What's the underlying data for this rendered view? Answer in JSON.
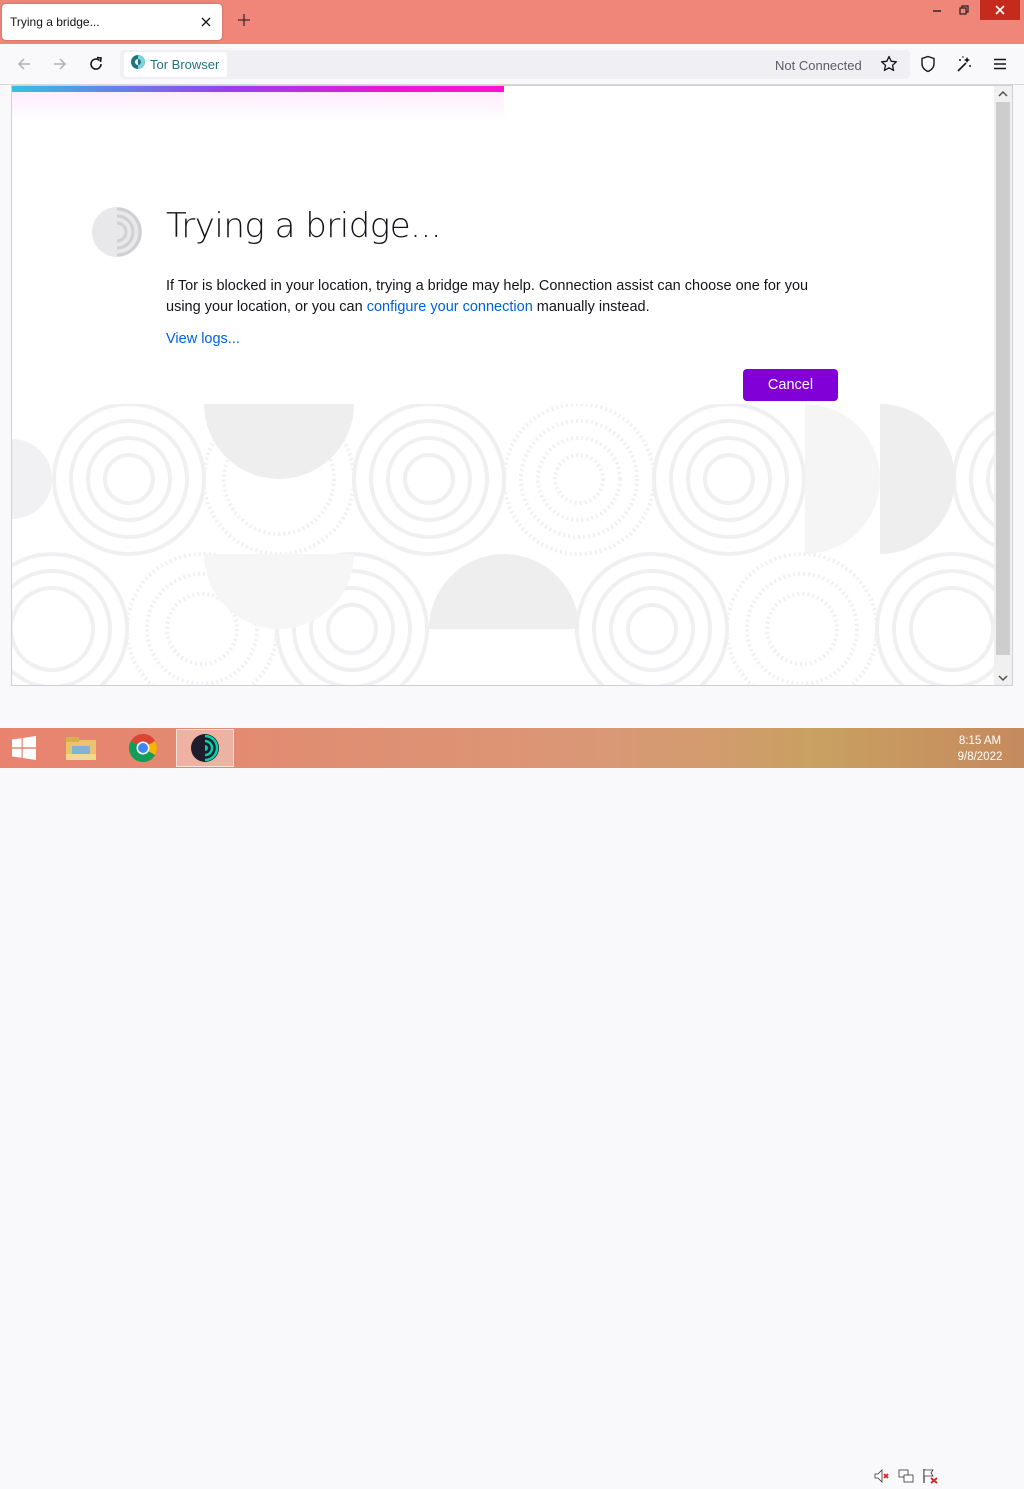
{
  "window": {
    "tab_title": "Trying a bridge...",
    "new_tab_symbol": "+"
  },
  "toolbar": {
    "identity_label": "Tor Browser",
    "connection_status": "Not Connected"
  },
  "page": {
    "heading": "Trying a bridge...",
    "description_part1": "If Tor is blocked in your location, trying a bridge may help. Connection assist can choose one for you using your location, or you can ",
    "description_link": "configure your connection",
    "description_part2": " manually instead.",
    "view_logs": "View logs...",
    "cancel_label": "Cancel"
  },
  "taskbar": {
    "time": "8:15 AM",
    "date": "9/8/2022"
  },
  "colors": {
    "titlebar": "#f0857a",
    "accent_purple": "#8000d7",
    "link_blue": "#0061e0",
    "tor_teal": "#20747e"
  },
  "icons": [
    "close-icon",
    "plus-icon",
    "back-icon",
    "forward-icon",
    "reload-icon",
    "tor-onion-icon",
    "star-icon",
    "shield-icon",
    "new-identity-icon",
    "menu-icon",
    "windows-start-icon",
    "file-explorer-icon",
    "chrome-icon",
    "tor-browser-icon",
    "volume-muted-icon",
    "network-icon",
    "flag-icon"
  ]
}
